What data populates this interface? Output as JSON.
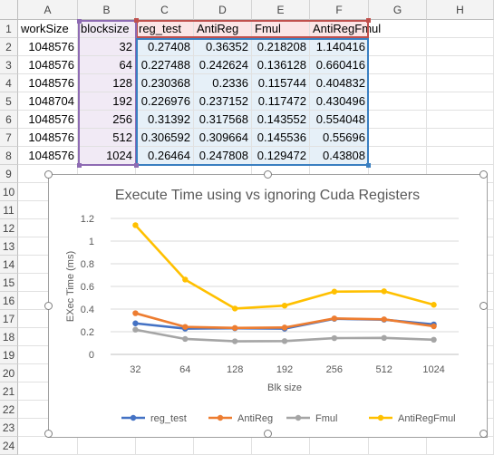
{
  "columns": [
    "A",
    "B",
    "C",
    "D",
    "E",
    "F",
    "G",
    "H"
  ],
  "rows": [
    "1",
    "2",
    "3",
    "4",
    "5",
    "6",
    "7",
    "8",
    "9",
    "10",
    "11",
    "12",
    "13",
    "14",
    "15",
    "16",
    "17",
    "18",
    "19",
    "20",
    "21",
    "22",
    "23",
    "24"
  ],
  "table": {
    "headers": [
      "workSize",
      "blocksize",
      "reg_test",
      "AntiReg",
      "Fmul",
      "AntiRegFmul"
    ],
    "data": [
      [
        "1048576",
        "32",
        "0.27408",
        "0.36352",
        "0.218208",
        "1.140416"
      ],
      [
        "1048576",
        "64",
        "0.227488",
        "0.242624",
        "0.136128",
        "0.660416"
      ],
      [
        "1048576",
        "128",
        "0.230368",
        "0.2336",
        "0.115744",
        "0.404832"
      ],
      [
        "1048704",
        "192",
        "0.226976",
        "0.237152",
        "0.117472",
        "0.430496"
      ],
      [
        "1048576",
        "256",
        "0.31392",
        "0.317568",
        "0.143552",
        "0.554048"
      ],
      [
        "1048576",
        "512",
        "0.306592",
        "0.309664",
        "0.145536",
        "0.55696"
      ],
      [
        "1048576",
        "1024",
        "0.26464",
        "0.247808",
        "0.129472",
        "0.43808"
      ]
    ]
  },
  "chart_data": {
    "type": "line",
    "title": "Execute Time using vs ignoring Cuda Registers",
    "xlabel": "Blk size",
    "ylabel": "EXec Time (ms)",
    "categories": [
      "32",
      "64",
      "128",
      "192",
      "256",
      "512",
      "1024"
    ],
    "ylim": [
      0,
      1.2
    ],
    "yticks": [
      "0",
      "0.2",
      "0.4",
      "0.6",
      "0.8",
      "1",
      "1.2"
    ],
    "grid": true,
    "legend_position": "bottom",
    "series": [
      {
        "name": "reg_test",
        "color": "#4472c4",
        "values": [
          0.27408,
          0.227488,
          0.230368,
          0.226976,
          0.31392,
          0.306592,
          0.26464
        ]
      },
      {
        "name": "AntiReg",
        "color": "#ed7d31",
        "values": [
          0.36352,
          0.242624,
          0.2336,
          0.237152,
          0.317568,
          0.309664,
          0.247808
        ]
      },
      {
        "name": "Fmul",
        "color": "#a5a5a5",
        "values": [
          0.218208,
          0.136128,
          0.115744,
          0.117472,
          0.143552,
          0.145536,
          0.129472
        ]
      },
      {
        "name": "AntiRegFmul",
        "color": "#ffc000",
        "values": [
          1.140416,
          0.660416,
          0.404832,
          0.430496,
          0.554048,
          0.55696,
          0.43808
        ]
      }
    ]
  },
  "colors": {
    "header_highlight": "#fbe5e6",
    "blocksize_highlight": "#f1eaf5",
    "data_highlight": "#e6f0f8"
  }
}
